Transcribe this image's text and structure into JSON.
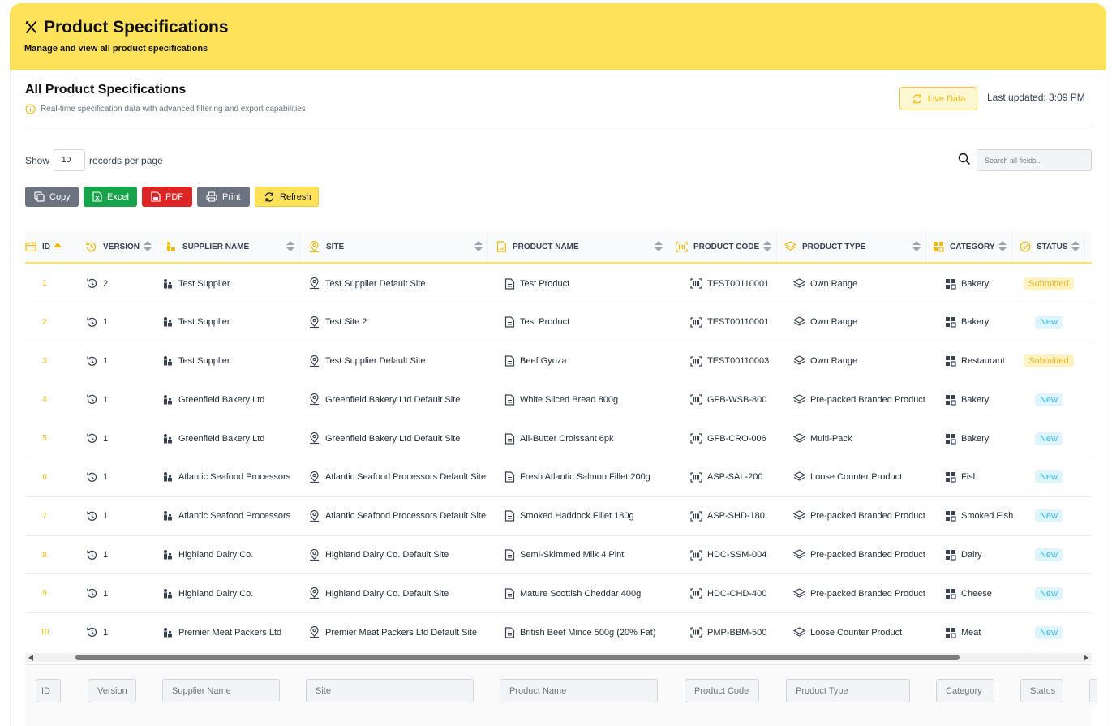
{
  "header": {
    "title": "Product Specifications",
    "subtitle": "Manage and view all product specifications"
  },
  "card": {
    "title": "All Product Specifications",
    "subtitle": "Real-time specification data with advanced filtering and export capabilities",
    "live_label": "Live Data",
    "last_updated": "Last updated: 3:09 PM"
  },
  "controls": {
    "show_label": "Show",
    "per_page_value": "10",
    "per_page_suffix": "records per page",
    "search_placeholder": "Search all fields..."
  },
  "buttons": {
    "copy": "Copy",
    "excel": "Excel",
    "pdf": "PDF",
    "print": "Print",
    "refresh": "Refresh"
  },
  "columns": {
    "id": "ID",
    "version": "VERSION",
    "supplier": "SUPPLIER NAME",
    "site": "SITE",
    "product": "PRODUCT NAME",
    "code": "PRODUCT CODE",
    "type": "PRODUCT TYPE",
    "category": "CATEGORY",
    "status": "STATUS"
  },
  "rows": [
    {
      "id": "1",
      "version": "2",
      "supplier": "Test Supplier",
      "site": "Test Supplier Default Site",
      "product": "Test Product",
      "code": "TEST00110001",
      "type": "Own Range",
      "category": "Bakery",
      "status": "Submitted"
    },
    {
      "id": "2",
      "version": "1",
      "supplier": "Test Supplier",
      "site": "Test Site 2",
      "product": "Test Product",
      "code": "TEST00110001",
      "type": "Own Range",
      "category": "Bakery",
      "status": "New"
    },
    {
      "id": "3",
      "version": "1",
      "supplier": "Test Supplier",
      "site": "Test Supplier Default Site",
      "product": "Beef Gyoza",
      "code": "TEST00110003",
      "type": "Own Range",
      "category": "Restaurant",
      "status": "Submitted"
    },
    {
      "id": "4",
      "version": "1",
      "supplier": "Greenfield Bakery Ltd",
      "site": "Greenfield Bakery Ltd Default Site",
      "product": "White Sliced Bread 800g",
      "code": "GFB-WSB-800",
      "type": "Pre-packed Branded Product",
      "category": "Bakery",
      "status": "New"
    },
    {
      "id": "5",
      "version": "1",
      "supplier": "Greenfield Bakery Ltd",
      "site": "Greenfield Bakery Ltd Default Site",
      "product": "All-Butter Croissant 6pk",
      "code": "GFB-CRO-006",
      "type": "Multi-Pack",
      "category": "Bakery",
      "status": "New"
    },
    {
      "id": "6",
      "version": "1",
      "supplier": "Atlantic Seafood Processors",
      "site": "Atlantic Seafood Processors Default Site",
      "product": "Fresh Atlantic Salmon Fillet 200g",
      "code": "ASP-SAL-200",
      "type": "Loose Counter Product",
      "category": "Fish",
      "status": "New"
    },
    {
      "id": "7",
      "version": "1",
      "supplier": "Atlantic Seafood Processors",
      "site": "Atlantic Seafood Processors Default Site",
      "product": "Smoked Haddock Fillet 180g",
      "code": "ASP-SHD-180",
      "type": "Pre-packed Branded Product",
      "category": "Smoked Fish",
      "status": "New"
    },
    {
      "id": "8",
      "version": "1",
      "supplier": "Highland Dairy Co.",
      "site": "Highland Dairy Co. Default Site",
      "product": "Semi-Skimmed Milk 4 Pint",
      "code": "HDC-SSM-004",
      "type": "Pre-packed Branded Product",
      "category": "Dairy",
      "status": "New"
    },
    {
      "id": "9",
      "version": "1",
      "supplier": "Highland Dairy Co.",
      "site": "Highland Dairy Co. Default Site",
      "product": "Mature Scottish Cheddar 400g",
      "code": "HDC-CHD-400",
      "type": "Pre-packed Branded Product",
      "category": "Cheese",
      "status": "New"
    },
    {
      "id": "10",
      "version": "1",
      "supplier": "Premier Meat Packers Ltd",
      "site": "Premier Meat Packers Ltd Default Site",
      "product": "British Beef Mince 500g (20% Fat)",
      "code": "PMP-BBM-500",
      "type": "Loose Counter Product",
      "category": "Meat",
      "status": "New"
    }
  ],
  "filters": {
    "id": "ID",
    "version": "Version",
    "supplier": "Supplier Name",
    "site": "Site",
    "product": "Product Name",
    "code": "Product Code",
    "type": "Product Type",
    "category": "Category",
    "status": "Status"
  },
  "colors": {
    "accent": "#fde25a",
    "id_text": "#f0b90b",
    "submitted": "#e8b923",
    "new": "#38b6d8"
  }
}
